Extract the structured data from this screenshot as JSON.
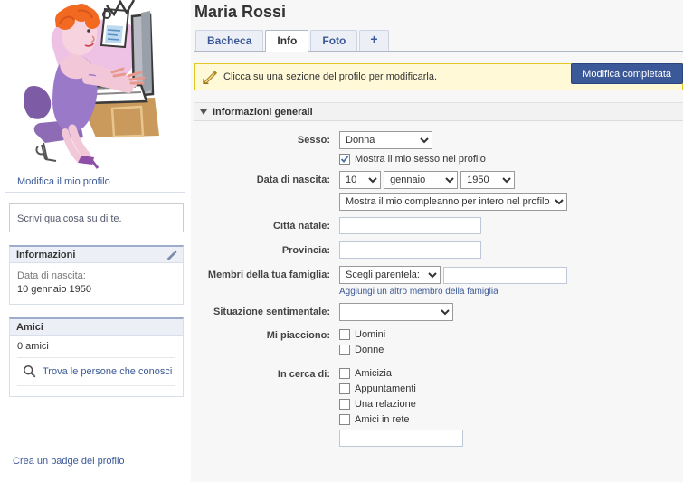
{
  "sidebar": {
    "avatar_alt": "woman-at-computer-illustration",
    "edit_profile_link": "Modifica il mio profilo",
    "about_placeholder": "Scrivi qualcosa su di te.",
    "info_panel": {
      "title": "Informazioni",
      "edit_icon": "pencil-icon",
      "birthday_label": "Data di nascita:",
      "birthday_value": "10 gennaio 1950"
    },
    "friends_panel": {
      "title": "Amici",
      "count_text": "0 amici",
      "find_icon": "magnifier-icon",
      "find_link": "Trova le persone che conosci"
    },
    "badge_link": "Crea un badge del profilo"
  },
  "header": {
    "profile_name": "Maria Rossi",
    "tabs": [
      {
        "label": "Bacheca",
        "active": false
      },
      {
        "label": "Info",
        "active": true
      },
      {
        "label": "Foto",
        "active": false
      },
      {
        "label": "+",
        "active": false
      }
    ]
  },
  "notice": {
    "icon": "pencil-edit-icon",
    "text": "Clicca su una sezione del profilo per modificarla.",
    "button_label": "Modifica completata"
  },
  "section": {
    "caret": "caret-down-icon",
    "title": "Informazioni generali"
  },
  "form": {
    "gender": {
      "label": "Sesso:",
      "value": "Donna",
      "show_checkbox_label": "Mostra il mio sesso nel profilo",
      "show_checkbox_checked": true
    },
    "birthdate": {
      "label": "Data di nascita:",
      "day": "10",
      "month": "gennaio",
      "year": "1950",
      "visibility": "Mostra il mio compleanno per intero nel profilo."
    },
    "hometown": {
      "label": "Città natale:",
      "value": ""
    },
    "province": {
      "label": "Provincia:",
      "value": ""
    },
    "family": {
      "label": "Membri della tua famiglia:",
      "relation_value": "Scegli parentela:",
      "name_value": "",
      "add_link": "Aggiungi un altro membro della famiglia"
    },
    "relationship": {
      "label": "Situazione sentimentale:",
      "value": ""
    },
    "interested_in": {
      "label": "Mi piacciono:",
      "options": [
        {
          "label": "Uomini",
          "checked": false
        },
        {
          "label": "Donne",
          "checked": false
        }
      ]
    },
    "looking_for": {
      "label": "In cerca di:",
      "options": [
        {
          "label": "Amicizia",
          "checked": false
        },
        {
          "label": "Appuntamenti",
          "checked": false
        },
        {
          "label": "Una relazione",
          "checked": false
        },
        {
          "label": "Amici in rete",
          "checked": false
        }
      ]
    }
  },
  "colors": {
    "brand_blue": "#3B5998",
    "link_blue": "#3B5998",
    "notice_bg": "#FFF9D7",
    "notice_border": "#E2C822",
    "panel_header_bg": "#ECEFF5",
    "content_bg": "#F7F7F7"
  }
}
